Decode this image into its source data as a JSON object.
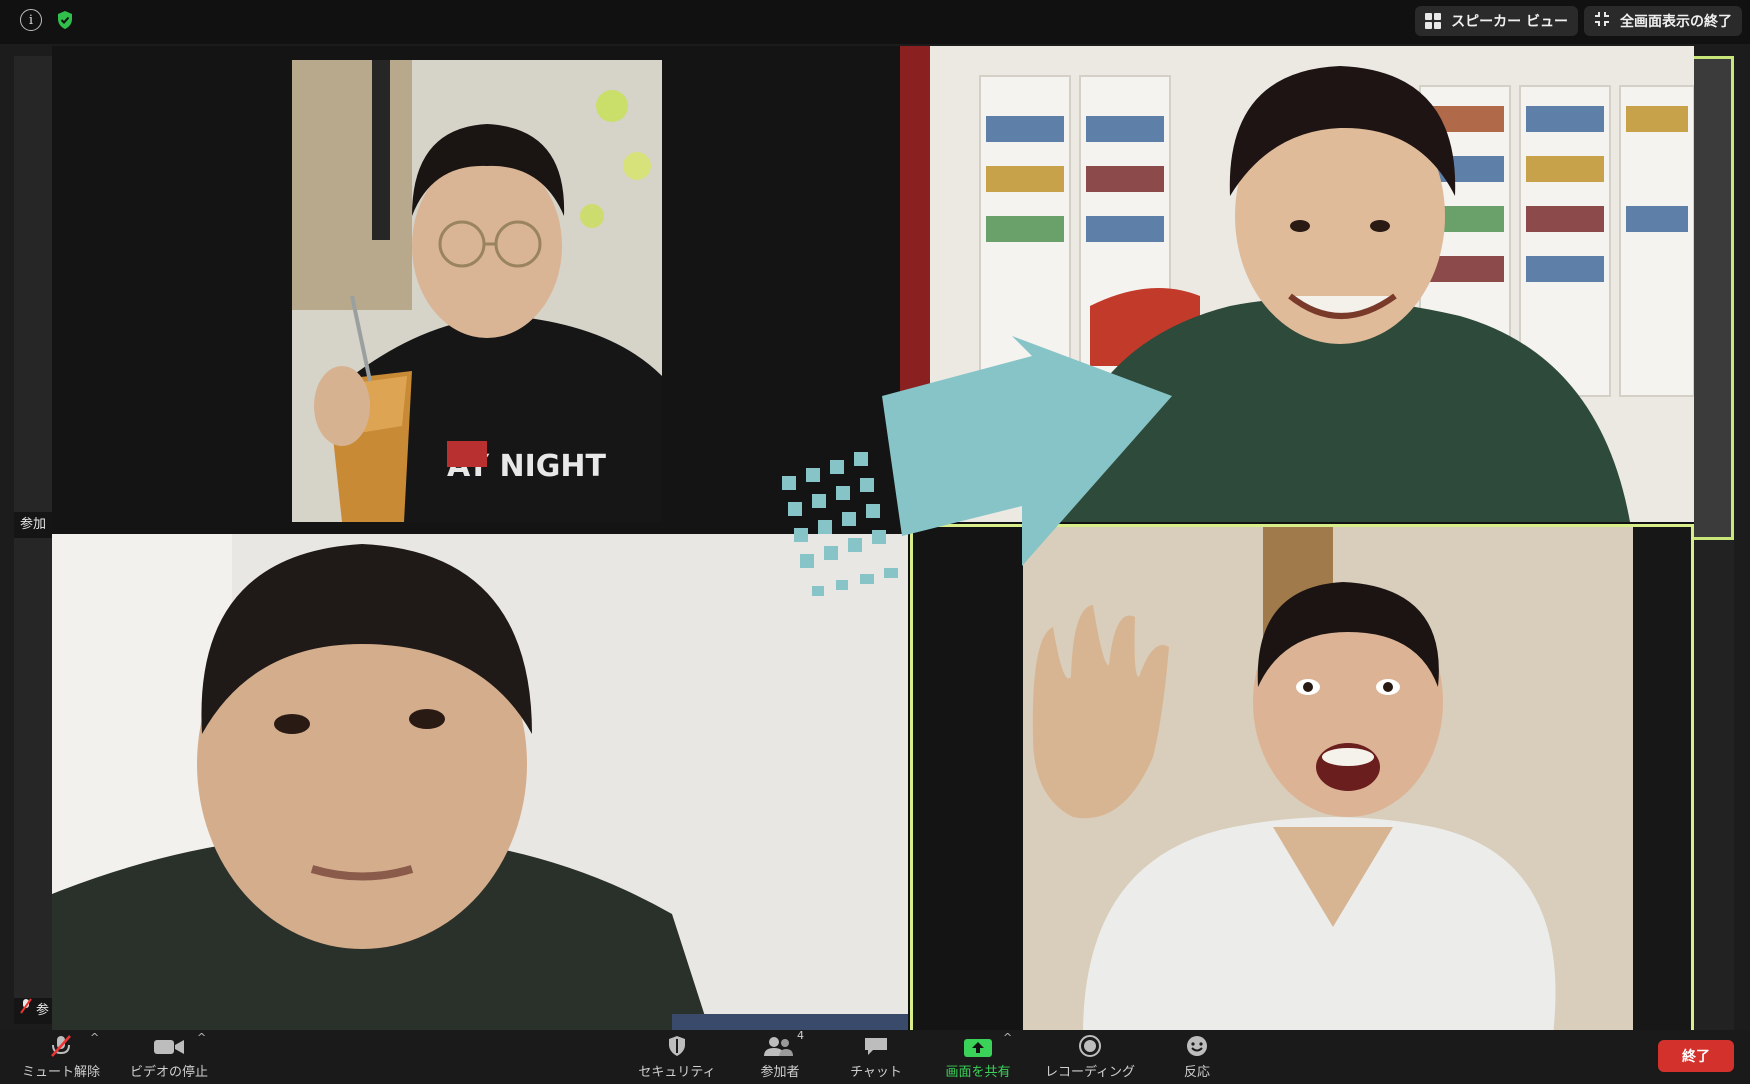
{
  "topbar": {
    "info_icon_glyph": "i",
    "speaker_view_label": "スピーカー ビュー",
    "exit_fullscreen_label": "全画面表示の終了"
  },
  "side_tiles": {
    "left_name_1": "参加",
    "left_name_2": "参"
  },
  "toolbar": {
    "unmute_label": "ミュート解除",
    "stop_video_label": "ビデオの停止",
    "security_label": "セキュリティ",
    "participants_label": "参加者",
    "participants_count": "4",
    "chat_label": "チャット",
    "share_screen_label": "画面を共有",
    "recording_label": "レコーディング",
    "reactions_label": "反応",
    "end_label": "終了"
  },
  "colors": {
    "active_speaker_border": "#d7ee8a",
    "share_green": "#3bd25a",
    "end_red": "#d3312b",
    "arrow_teal": "#86c4c7",
    "shield_green": "#2fbf4a"
  },
  "icons": {
    "info": "info-icon",
    "shield": "shield-check-icon",
    "speaker_view": "grid-icon",
    "exit_fullscreen": "exit-fullscreen-icon",
    "mic_muted": "mic-muted-icon",
    "video": "video-camera-icon",
    "security": "shield-icon",
    "participants": "people-icon",
    "chat": "chat-bubble-icon",
    "share": "share-screen-icon",
    "record": "record-icon",
    "reactions": "smiley-icon"
  }
}
